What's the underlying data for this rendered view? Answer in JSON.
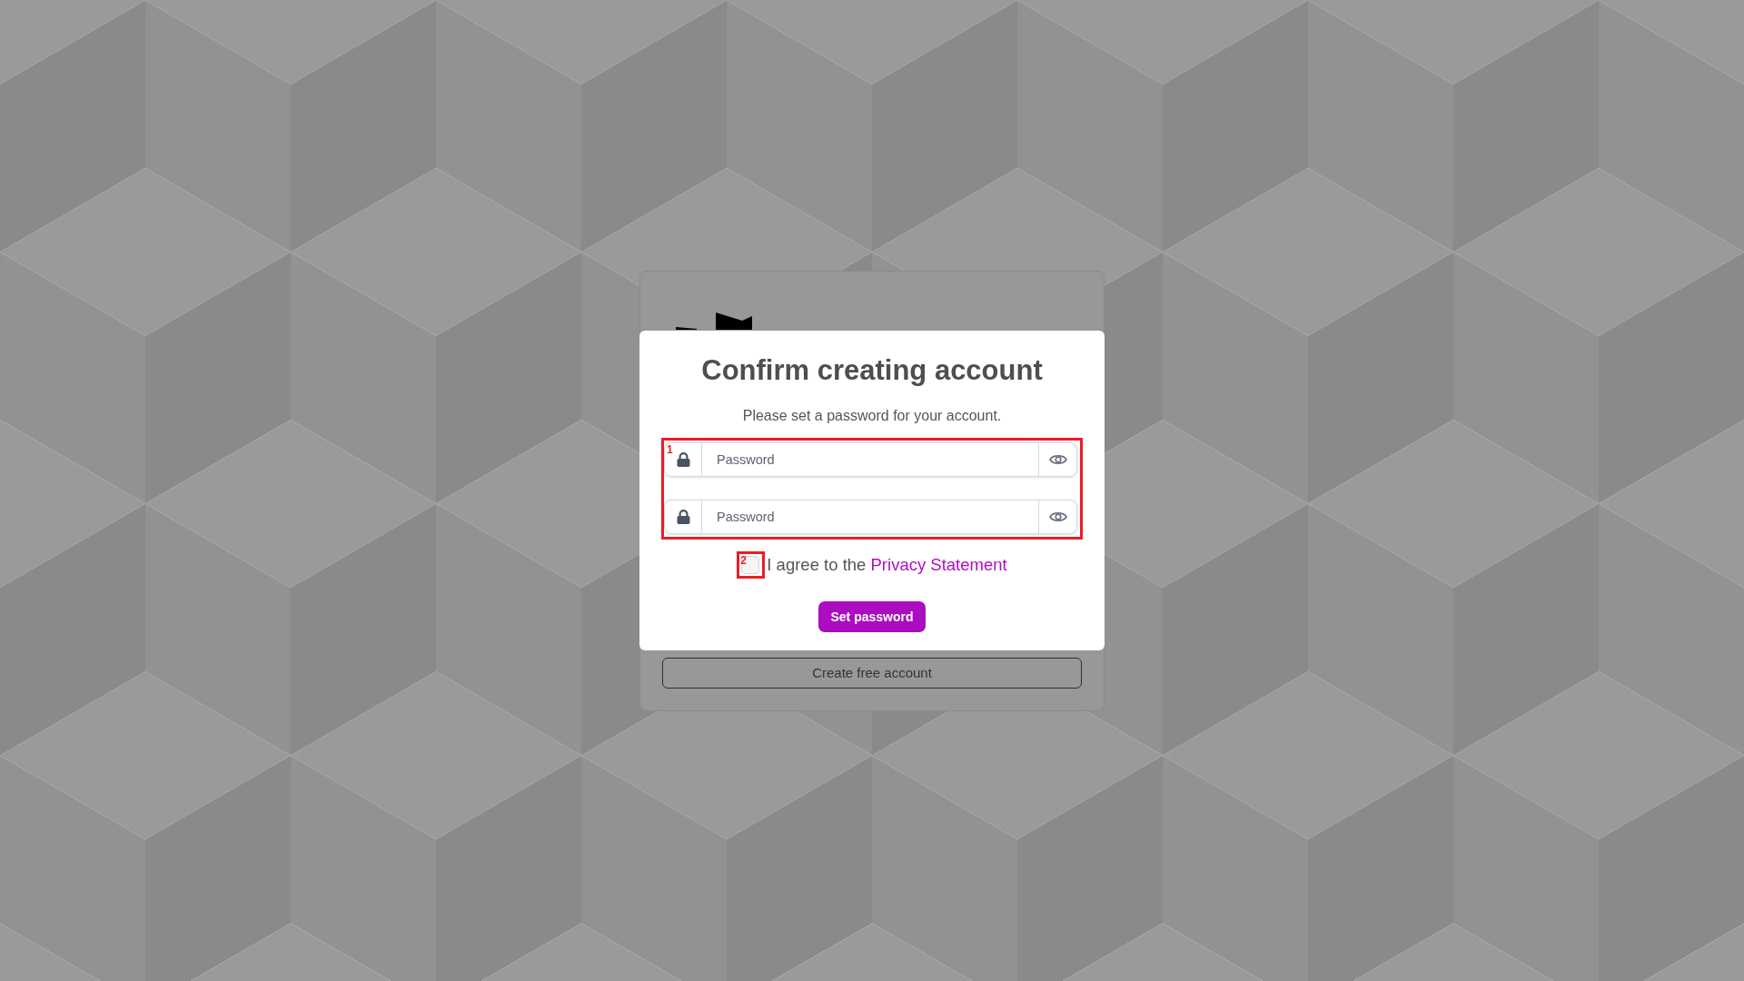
{
  "login_card": {
    "create_account_button": "Create free account"
  },
  "dialog": {
    "title": "Confirm creating account",
    "subtitle": "Please set a password for your account.",
    "password_group": {
      "marker": "1",
      "fields": [
        {
          "placeholder": "Password"
        },
        {
          "placeholder": "Password"
        }
      ]
    },
    "agreement": {
      "marker": "2",
      "checked": false,
      "text": "I agree to the",
      "link": "Privacy Statement"
    },
    "submit_button": "Set password"
  }
}
